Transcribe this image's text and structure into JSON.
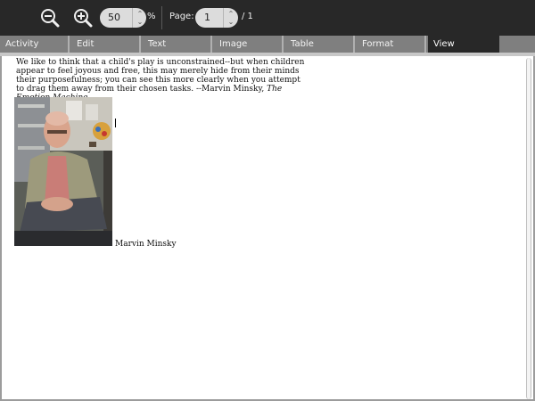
{
  "toolbar": {
    "zoom_value": "50",
    "zoom_unit": "%",
    "page_label": "Page:",
    "page_value": "1",
    "page_total": "/ 1",
    "icons": [
      "zoom-out-icon",
      "zoom-in-icon",
      "spin-up-icon",
      "spin-down-icon"
    ]
  },
  "tabs": [
    {
      "label": "Activity",
      "active": false
    },
    {
      "label": "Edit",
      "active": false
    },
    {
      "label": "Text",
      "active": false
    },
    {
      "label": "Image",
      "active": false
    },
    {
      "label": "Table",
      "active": false
    },
    {
      "label": "Format",
      "active": false
    },
    {
      "label": "View",
      "active": true
    }
  ],
  "document": {
    "quote_text": "We like to think that a child's play is unconstrained--but when children appear to feel joyous and free, this may merely hide from their minds their purposefulness; you can see this more clearly when you attempt to drag them away from their chosen tasks. --Marvin Minsky,",
    "quote_source": "The Emotion Machine",
    "caption": "Marvin Minsky"
  },
  "colors": {
    "toolbar_bg": "#282828",
    "tabbar_bg": "#7f7f7f",
    "active_tab_bg": "#282828",
    "document_bg": "#ffffff"
  }
}
